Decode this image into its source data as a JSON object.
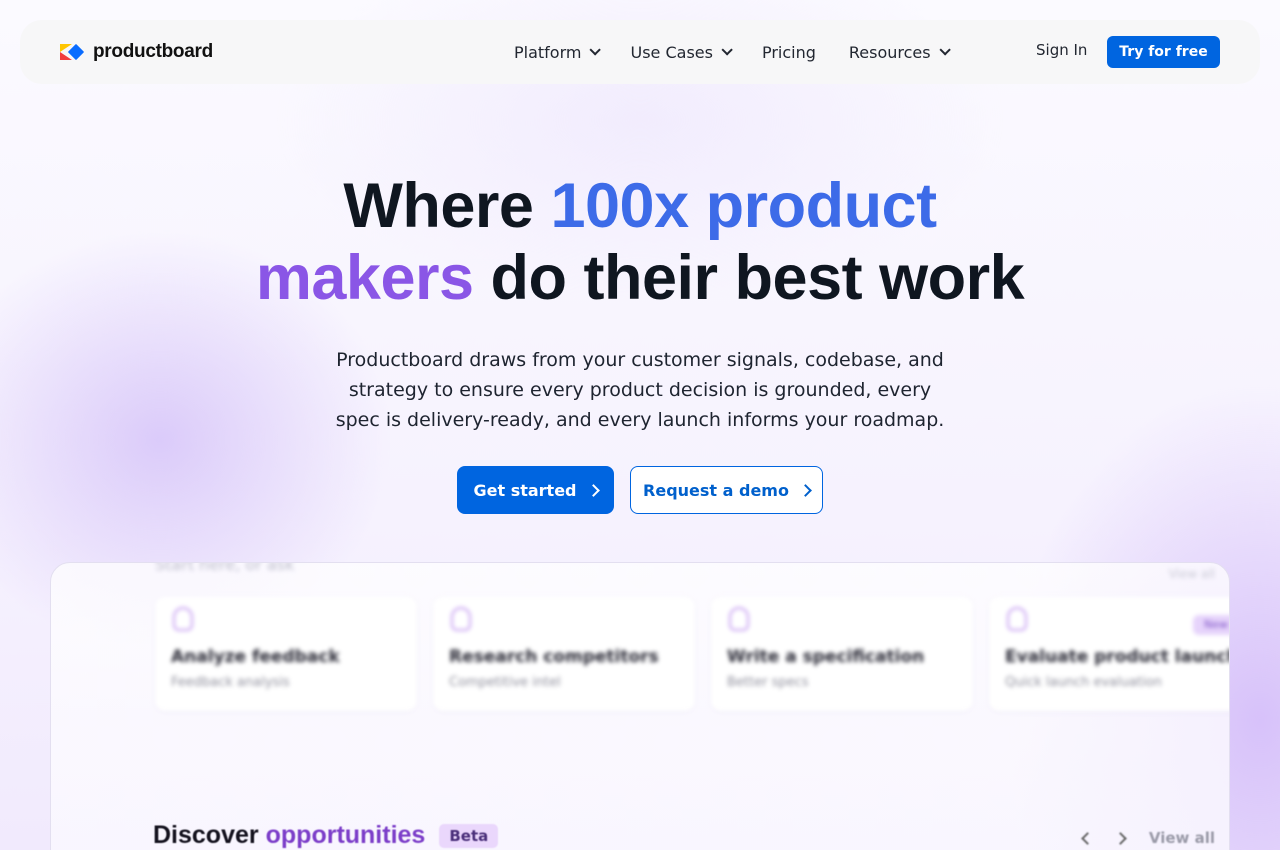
{
  "brand": {
    "name": "productboard",
    "accent": "#0065e0"
  },
  "nav": {
    "items": [
      {
        "label": "Platform",
        "has_dropdown": true
      },
      {
        "label": "Use Cases",
        "has_dropdown": true
      },
      {
        "label": "Pricing",
        "has_dropdown": false
      },
      {
        "label": "Resources",
        "has_dropdown": true
      }
    ],
    "sign_in": "Sign In",
    "try_free": "Try for free"
  },
  "hero": {
    "title_part1": "Where ",
    "title_highlight1": "100x product",
    "title_highlight2": "makers",
    "title_part2": " do their best work",
    "subtitle": "Productboard draws from your customer signals, codebase, and strategy to ensure every product decision is grounded, every spec is delivery-ready, and every launch informs your roadmap.",
    "primary_cta": "Get started",
    "secondary_cta": "Request a demo"
  },
  "preview": {
    "top_label": "Start here, or ask",
    "top_view_all": "View all",
    "cards": [
      {
        "title": "Analyze feedback",
        "subtitle": "Feedback analysis",
        "icon": "bulb-icon"
      },
      {
        "title": "Research competitors",
        "subtitle": "Competitive intel",
        "icon": "trophy-icon"
      },
      {
        "title": "Write a specification",
        "subtitle": "Better specs",
        "icon": "document-icon"
      },
      {
        "title": "Evaluate product launch",
        "subtitle": "Quick launch evaluation",
        "icon": "rocket-icon",
        "badge": "New"
      }
    ],
    "section_title": "Discover",
    "section_highlight": "opportunities",
    "section_badge": "Beta",
    "view_all": "View all"
  }
}
